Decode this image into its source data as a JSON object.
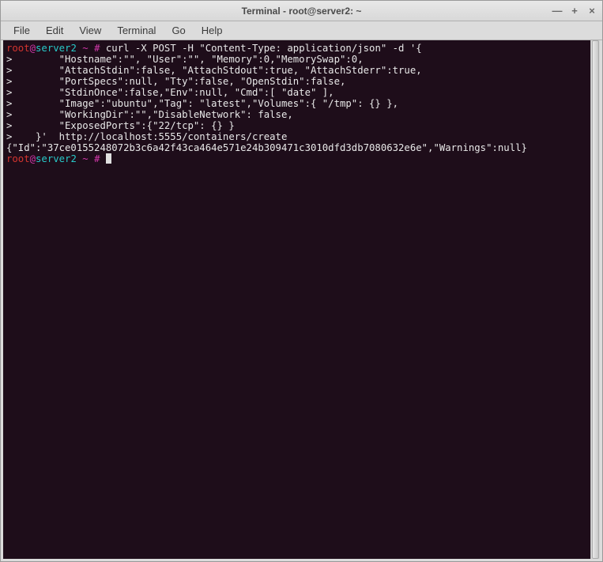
{
  "window": {
    "title": "Terminal - root@server2: ~",
    "minimize": "—",
    "maximize": "+",
    "close": "×"
  },
  "menu": {
    "file": "File",
    "edit": "Edit",
    "view": "View",
    "terminal": "Terminal",
    "go": "Go",
    "help": "Help"
  },
  "prompt": {
    "user": "root",
    "at": "@",
    "host": "server2",
    "path": " ~ #",
    "space": " "
  },
  "lines": {
    "l0_cmd": "curl -X POST -H \"Content-Type: application/json\" -d '{",
    "l1": ">        \"Hostname\":\"\", \"User\":\"\", \"Memory\":0,\"MemorySwap\":0,",
    "l2": ">        \"AttachStdin\":false, \"AttachStdout\":true, \"AttachStderr\":true,",
    "l3": ">        \"PortSpecs\":null, \"Tty\":false, \"OpenStdin\":false,",
    "l4": ">        \"StdinOnce\":false,\"Env\":null, \"Cmd\":[ \"date\" ],",
    "l5": ">        \"Image\":\"ubuntu\",\"Tag\": \"latest\",\"Volumes\":{ \"/tmp\": {} },",
    "l6": ">        \"WorkingDir\":\"\",\"DisableNetwork\": false,",
    "l7": ">        \"ExposedPorts\":{\"22/tcp\": {} }",
    "l8": ">    }'  http://localhost:5555/containers/create",
    "l9": "{\"Id\":\"37ce0155248072b3c6a42f43ca464e571e24b309471c3010dfd3db7080632e6e\",\"Warnings\":null}"
  }
}
